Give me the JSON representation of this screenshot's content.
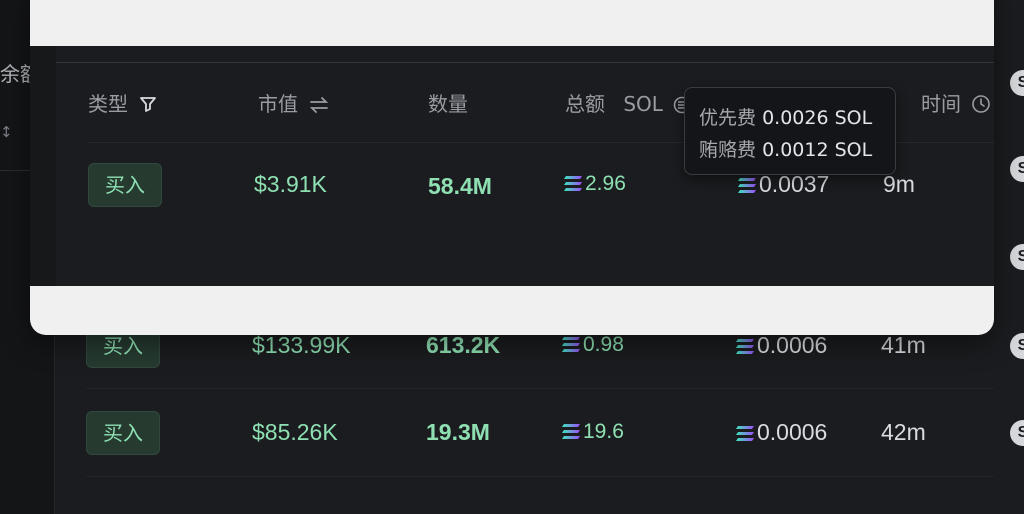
{
  "background_sidebar": {
    "clipped_label": "余额",
    "sort_glyph": "↕"
  },
  "modal": {
    "headers": {
      "type": "类型",
      "market_cap": "市值",
      "quantity": "数量",
      "total": "总额",
      "total_unit": "SOL",
      "time_partial": "时间"
    },
    "row": {
      "type": "买入",
      "market_cap": "$3.91K",
      "quantity": "58.4M",
      "total": "2.96",
      "fee": "0.0037",
      "time": "9m"
    }
  },
  "tooltip": {
    "priority_fee_label": "优先费",
    "priority_fee_value": "0.0026 SOL",
    "bribe_fee_label": "贿赂费",
    "bribe_fee_value": "0.0012 SOL"
  },
  "background_table": {
    "rows": [
      {
        "type": "买入",
        "market_cap": "$133.99K",
        "quantity": "613.2K",
        "total": "0.98",
        "fee": "0.0006",
        "time": "41m"
      },
      {
        "type": "买入",
        "market_cap": "$85.26K",
        "quantity": "19.3M",
        "total": "19.6",
        "fee": "0.0006",
        "time": "42m"
      }
    ]
  },
  "icons": {
    "filter": "filter-icon",
    "swap": "swap-icon",
    "sol": "sol-icon",
    "clock": "clock-icon",
    "coin": "coin-icon"
  },
  "colors": {
    "positive": "#8ee0b2",
    "modal_frame": "#f0f0f0",
    "tooltip_background": "#141518"
  }
}
